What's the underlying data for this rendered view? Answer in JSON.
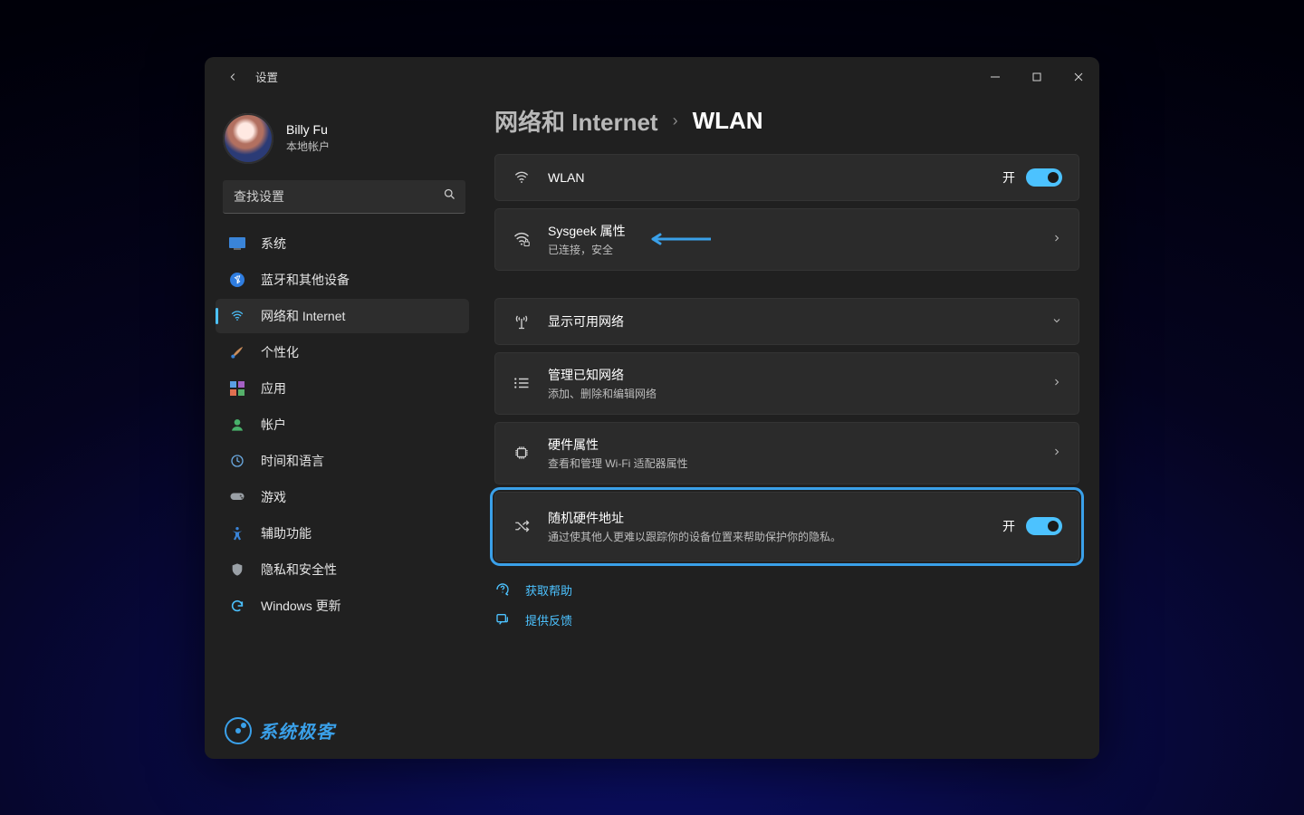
{
  "window": {
    "title": "设置"
  },
  "user": {
    "name": "Billy Fu",
    "account_type": "本地帐户"
  },
  "search": {
    "placeholder": "查找设置"
  },
  "sidebar": {
    "items": [
      {
        "label": "系统"
      },
      {
        "label": "蓝牙和其他设备"
      },
      {
        "label": "网络和 Internet"
      },
      {
        "label": "个性化"
      },
      {
        "label": "应用"
      },
      {
        "label": "帐户"
      },
      {
        "label": "时间和语言"
      },
      {
        "label": "游戏"
      },
      {
        "label": "辅助功能"
      },
      {
        "label": "隐私和安全性"
      },
      {
        "label": "Windows 更新"
      }
    ],
    "active_index": 2
  },
  "breadcrumb": {
    "parent": "网络和 Internet",
    "current": "WLAN"
  },
  "cards": {
    "wlan": {
      "title": "WLAN",
      "state_label": "开",
      "state": true
    },
    "network": {
      "title": "Sysgeek 属性",
      "sub": "已连接，安全"
    },
    "available": {
      "title": "显示可用网络"
    },
    "known": {
      "title": "管理已知网络",
      "sub": "添加、删除和编辑网络"
    },
    "hardware": {
      "title": "硬件属性",
      "sub": "查看和管理 Wi-Fi 适配器属性"
    },
    "random_mac": {
      "title": "随机硬件地址",
      "sub": "通过使其他人更难以跟踪你的设备位置来帮助保护你的隐私。",
      "state_label": "开",
      "state": true
    }
  },
  "links": {
    "help": "获取帮助",
    "feedback": "提供反馈"
  },
  "watermark": {
    "text": "系统极客"
  }
}
